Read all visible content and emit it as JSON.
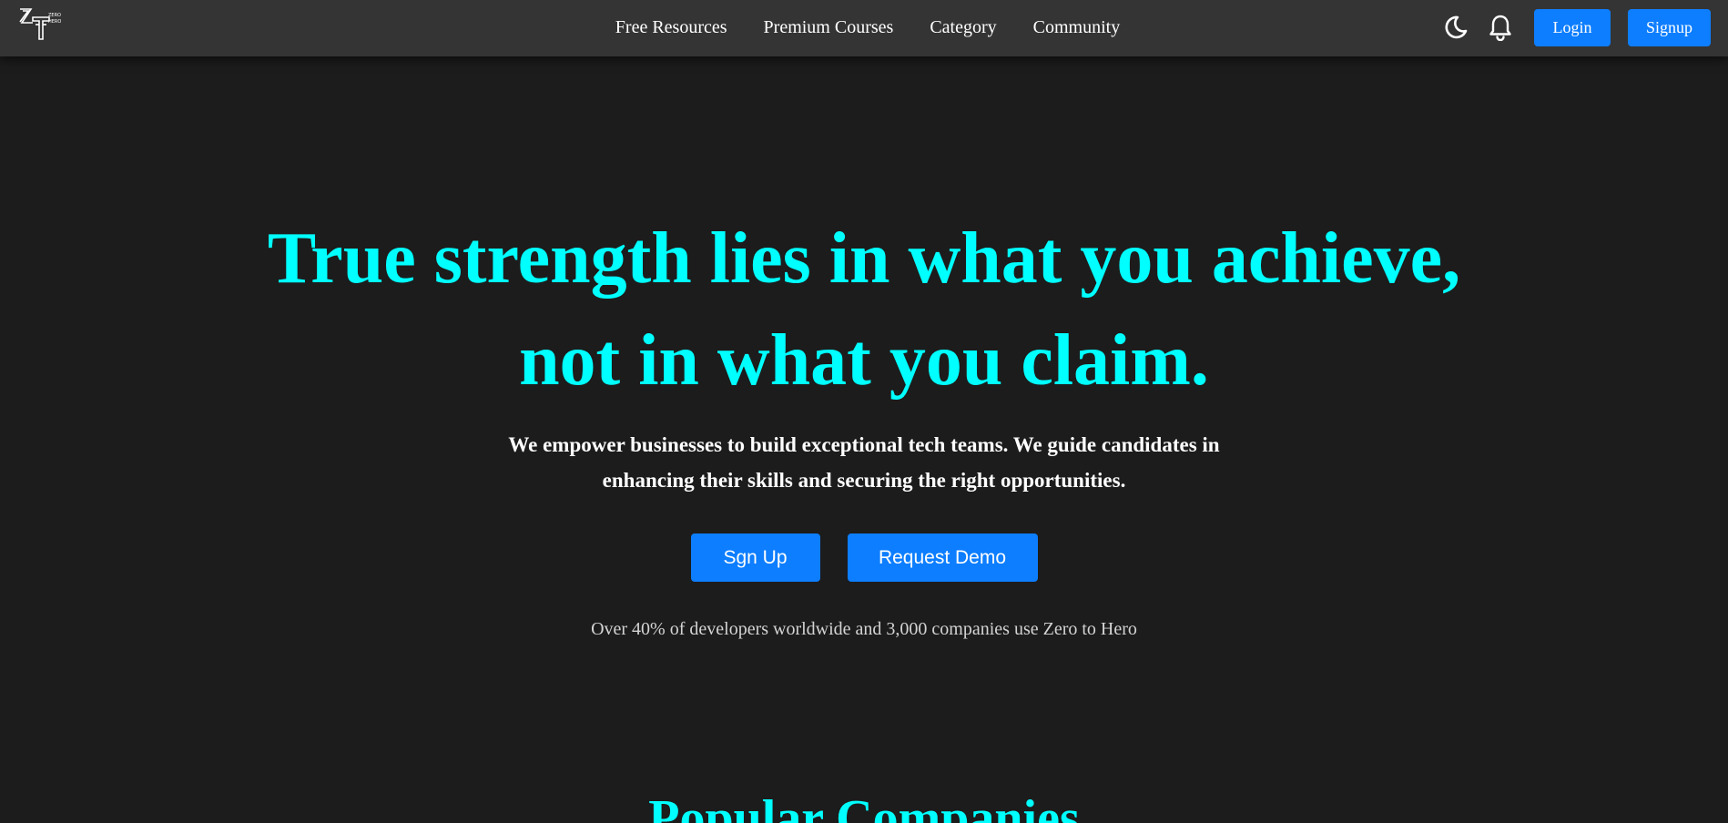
{
  "nav": {
    "logo_icon": "zero-to-hero-logo",
    "links": [
      {
        "label": "Free Resources"
      },
      {
        "label": "Premium Courses"
      },
      {
        "label": "Category"
      },
      {
        "label": "Community"
      }
    ],
    "theme_icon": "moon-icon",
    "notification_icon": "bell-icon",
    "login_label": "Login",
    "signup_label": "Signup"
  },
  "hero": {
    "headline_line1": "True strength lies in what you achieve,",
    "headline_line2": "not in what you claim.",
    "subtitle_line1": "We empower businesses to build exceptional tech teams. We guide candidates in",
    "subtitle_line2": "enhancing their skills and securing the right opportunities.",
    "primary_cta": "Sgn Up",
    "secondary_cta": "Request Demo",
    "stat_text": "Over 40% of developers worldwide and 3,000 companies use Zero to Hero"
  },
  "companies": {
    "title": "Popular Companies"
  },
  "colors": {
    "background": "#1c1c1c",
    "navbar": "#343434",
    "accent": "#00ffff",
    "button": "#0d7eff",
    "muted_text": "#d4d4d4"
  }
}
